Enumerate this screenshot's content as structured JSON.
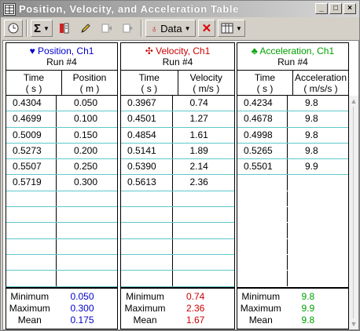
{
  "window": {
    "title": "Position, Velocity, and Acceleration Table",
    "controls": [
      "_",
      "□",
      "×"
    ]
  },
  "toolbar": {
    "data_label": "Data"
  },
  "panels": [
    {
      "icon": "♥",
      "channel": "Position, Ch1",
      "run": "Run #4",
      "color": "#0000cc",
      "col1": [
        "Time",
        "( s )"
      ],
      "col2": [
        "Position",
        "( m )"
      ],
      "rows": [
        [
          "0.4304",
          "0.050"
        ],
        [
          "0.4699",
          "0.100"
        ],
        [
          "0.5009",
          "0.150"
        ],
        [
          "0.5273",
          "0.200"
        ],
        [
          "0.5507",
          "0.250"
        ],
        [
          "0.5719",
          "0.300"
        ]
      ],
      "stats": {
        "minimum": "0.050",
        "maximum": "0.300",
        "mean": "0.175"
      }
    },
    {
      "icon": "✣",
      "channel": "Velocity, Ch1",
      "run": "Run #4",
      "color": "#cc0000",
      "col1": [
        "Time",
        "( s )"
      ],
      "col2": [
        "Velocity",
        "( m/s )"
      ],
      "rows": [
        [
          "0.3967",
          "0.74"
        ],
        [
          "0.4501",
          "1.27"
        ],
        [
          "0.4854",
          "1.61"
        ],
        [
          "0.5141",
          "1.89"
        ],
        [
          "0.5390",
          "2.14"
        ],
        [
          "0.5613",
          "2.36"
        ]
      ],
      "stats": {
        "minimum": "0.74",
        "maximum": "2.36",
        "mean": "1.67"
      }
    },
    {
      "icon": "♣",
      "channel": "Acceleration, Ch1",
      "run": "Run #4",
      "color": "#00a000",
      "col1": [
        "Time",
        "( s )"
      ],
      "col2": [
        "Acceleration",
        "( m/s/s )"
      ],
      "rows": [
        [
          "0.4234",
          "9.8"
        ],
        [
          "0.4678",
          "9.8"
        ],
        [
          "0.4998",
          "9.8"
        ],
        [
          "0.5265",
          "9.8"
        ],
        [
          "0.5501",
          "9.9"
        ]
      ],
      "stats": {
        "minimum": "9.8",
        "maximum": "9.9",
        "mean": "9.8"
      }
    }
  ],
  "stat_labels": {
    "minimum": "Minimum",
    "maximum": "Maximum",
    "mean": "Mean"
  }
}
